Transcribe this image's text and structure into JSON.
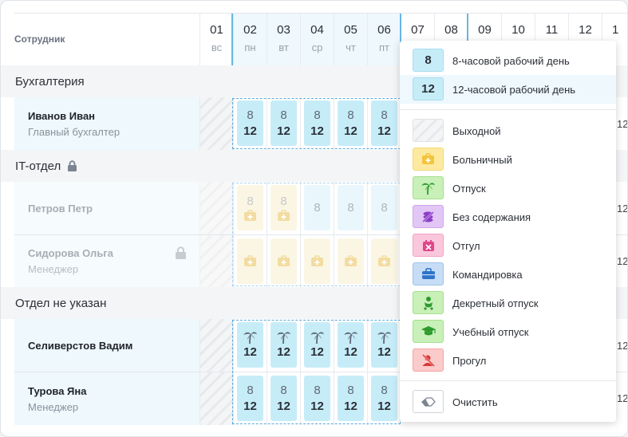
{
  "header": {
    "employee_col": "Сотрудник"
  },
  "days": [
    {
      "num": "01",
      "wd": "вс"
    },
    {
      "num": "02",
      "wd": "пн"
    },
    {
      "num": "03",
      "wd": "вт"
    },
    {
      "num": "04",
      "wd": "ср"
    },
    {
      "num": "05",
      "wd": "чт"
    },
    {
      "num": "06",
      "wd": "пт"
    },
    {
      "num": "07",
      "wd": ""
    },
    {
      "num": "08",
      "wd": ""
    },
    {
      "num": "09",
      "wd": ""
    },
    {
      "num": "10",
      "wd": ""
    },
    {
      "num": "11",
      "wd": ""
    },
    {
      "num": "12",
      "wd": ""
    },
    {
      "num": "1",
      "wd": ""
    }
  ],
  "departments": [
    {
      "name": "Бухгалтерия"
    },
    {
      "name": "IT-отдел"
    },
    {
      "name": "Отдел не указан"
    }
  ],
  "employees": [
    {
      "name": "Иванов Иван",
      "role": "Главный бухгалтер"
    },
    {
      "name": "Петров Петр",
      "role": ""
    },
    {
      "name": "Сидорова Ольга",
      "role": "Менеджер"
    },
    {
      "name": "Селиверстов Вадим",
      "role": ""
    },
    {
      "name": "Турова Яна",
      "role": "Менеджер"
    }
  ],
  "tiles": {
    "top8": "8",
    "bottom12": "12"
  },
  "dropdown": {
    "items": [
      {
        "icon": "8",
        "label": "8-часовой рабочий день",
        "color": "#c6ecf8"
      },
      {
        "icon": "12",
        "label": "12-часовой рабочий день",
        "color": "#c6ecf8"
      },
      {
        "icon": "weekend-stripes-icon",
        "label": "Выходной",
        "color": "#eceef0"
      },
      {
        "icon": "medkit-icon",
        "label": "Больничный",
        "color": "#fdeaa0"
      },
      {
        "icon": "palm-icon",
        "label": "Отпуск",
        "color": "#c8f0b8"
      },
      {
        "icon": "coins-icon",
        "label": "Без содержания",
        "color": "#e2c6f5"
      },
      {
        "icon": "calendar-x-icon",
        "label": "Отгул",
        "color": "#fbc7dd"
      },
      {
        "icon": "briefcase-icon",
        "label": "Командировка",
        "color": "#c6ddf5"
      },
      {
        "icon": "baby-icon",
        "label": "Декретный отпуск",
        "color": "#c8f0b8"
      },
      {
        "icon": "graduation-cap-icon",
        "label": "Учебный отпуск",
        "color": "#c8f0b8"
      },
      {
        "icon": "user-x-icon",
        "label": "Прогул",
        "color": "#fbcaca"
      },
      {
        "icon": "eraser-icon",
        "label": "Очистить",
        "color": "#ffffff"
      }
    ]
  },
  "colors": {
    "accent": "#5aa9dc",
    "tile": "#c6ecf8",
    "row_selected": "#eef8fd"
  }
}
